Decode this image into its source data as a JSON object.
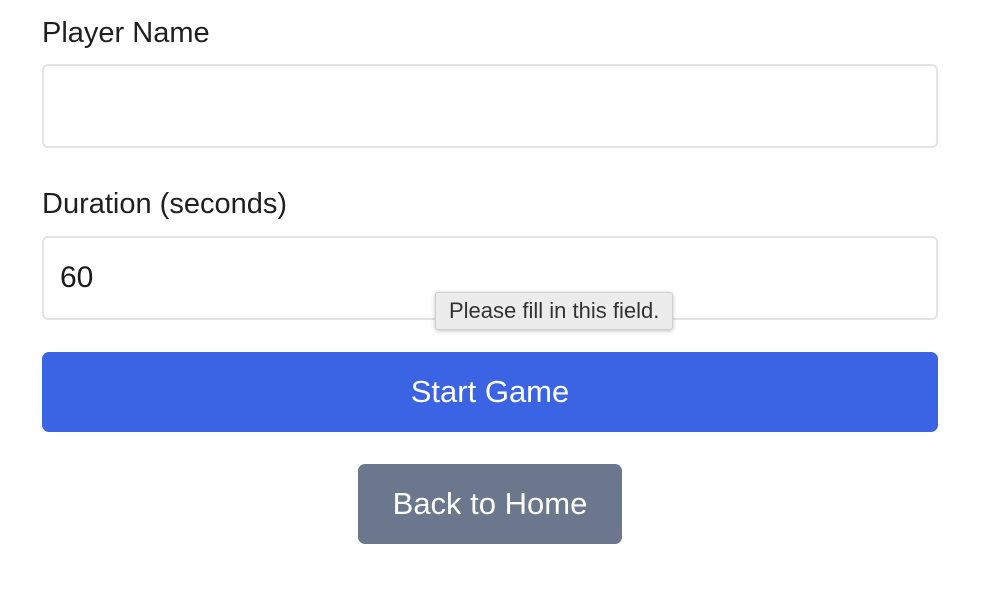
{
  "form": {
    "player_name": {
      "label": "Player Name",
      "value": "",
      "placeholder": ""
    },
    "duration": {
      "label": "Duration (seconds)",
      "value": "60"
    },
    "validation_tooltip": "Please fill in this field.",
    "start_button_label": "Start Game",
    "back_button_label": "Back to Home"
  },
  "colors": {
    "primary_button": "#3a64e3",
    "secondary_button": "#6b778c",
    "input_border": "#e3e3e3"
  }
}
